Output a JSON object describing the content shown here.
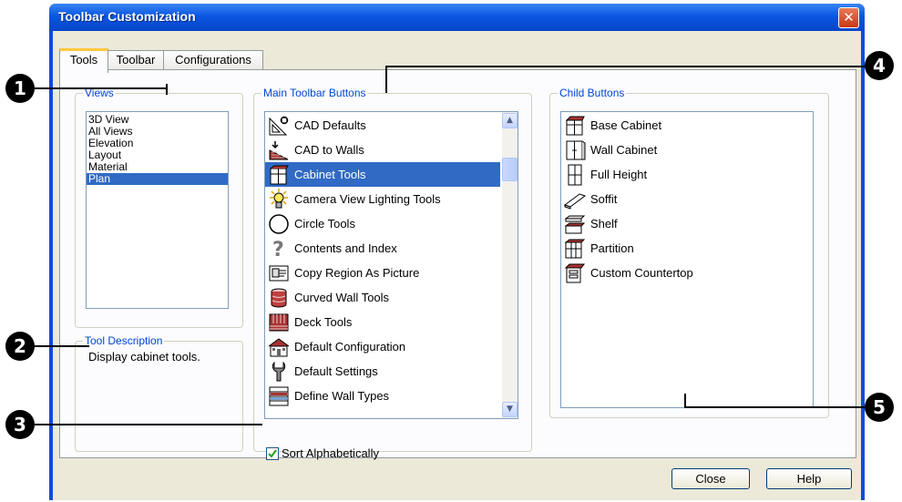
{
  "window": {
    "title": "Toolbar Customization",
    "close_glyph": "✕"
  },
  "tabs": [
    {
      "label": "Tools"
    },
    {
      "label": "Toolbar"
    },
    {
      "label": "Configurations"
    }
  ],
  "views": {
    "legend": "Views",
    "items": [
      "3D View",
      "All Views",
      "Elevation",
      "Layout",
      "Material",
      "Plan"
    ],
    "selected": "Plan"
  },
  "tool_description": {
    "legend": "Tool Description",
    "text": "Display cabinet tools."
  },
  "main_buttons": {
    "legend": "Main Toolbar Buttons",
    "items": [
      {
        "label": "CAD Defaults",
        "icon": "cad-defaults-icon"
      },
      {
        "label": "CAD to Walls",
        "icon": "cad-to-walls-icon"
      },
      {
        "label": "Cabinet Tools",
        "icon": "cabinet-icon"
      },
      {
        "label": "Camera View Lighting Tools",
        "icon": "light-bulb-icon"
      },
      {
        "label": "Circle Tools",
        "icon": "circle-icon"
      },
      {
        "label": "Contents and Index",
        "icon": "help-question-icon"
      },
      {
        "label": "Copy Region As Picture",
        "icon": "copy-picture-icon"
      },
      {
        "label": "Curved Wall Tools",
        "icon": "curved-wall-icon"
      },
      {
        "label": "Deck Tools",
        "icon": "deck-icon"
      },
      {
        "label": "Default Configuration",
        "icon": "house-icon"
      },
      {
        "label": "Default Settings",
        "icon": "wrench-icon"
      },
      {
        "label": "Define Wall Types",
        "icon": "wall-types-icon"
      }
    ],
    "selected": "Cabinet Tools"
  },
  "sort": {
    "label": "Sort Alphabetically",
    "checked": true
  },
  "child_buttons": {
    "legend": "Child Buttons",
    "items": [
      {
        "label": "Base Cabinet",
        "icon": "base-cabinet-icon"
      },
      {
        "label": "Wall Cabinet",
        "icon": "wall-cabinet-icon"
      },
      {
        "label": "Full Height",
        "icon": "full-height-cabinet-icon"
      },
      {
        "label": "Soffit",
        "icon": "soffit-icon"
      },
      {
        "label": "Shelf",
        "icon": "shelf-icon"
      },
      {
        "label": "Partition",
        "icon": "partition-icon"
      },
      {
        "label": "Custom Countertop",
        "icon": "countertop-icon"
      }
    ]
  },
  "buttons": {
    "close": "Close",
    "help": "Help"
  },
  "callouts": [
    "1",
    "2",
    "3",
    "4",
    "5"
  ],
  "colors": {
    "accent": "#316ac5",
    "titlebar": "#0a56e2",
    "legend": "#0046d5"
  }
}
